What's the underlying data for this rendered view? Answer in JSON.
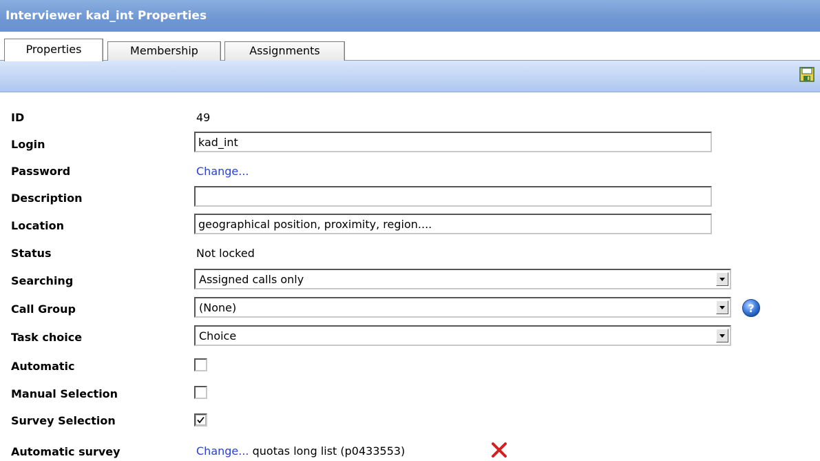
{
  "window": {
    "title": "Interviewer kad_int Properties"
  },
  "tabs": [
    {
      "label": "Properties",
      "active": true
    },
    {
      "label": "Membership",
      "active": false
    },
    {
      "label": "Assignments",
      "active": false
    }
  ],
  "toolbar": {
    "save_icon": "save-icon"
  },
  "form": {
    "id": {
      "label": "ID",
      "value": "49"
    },
    "login": {
      "label": "Login",
      "value": "kad_int"
    },
    "password": {
      "label": "Password",
      "link": "Change..."
    },
    "description": {
      "label": "Description",
      "value": ""
    },
    "location": {
      "label": "Location",
      "value": "geographical position, proximity, region...."
    },
    "status": {
      "label": "Status",
      "value": "Not locked"
    },
    "searching": {
      "label": "Searching",
      "value": "Assigned calls only"
    },
    "call_group": {
      "label": "Call Group",
      "value": "(None)",
      "help_icon": "help-icon"
    },
    "task_choice": {
      "label": "Task choice",
      "value": "Choice"
    },
    "automatic": {
      "label": "Automatic",
      "checked": false
    },
    "manual_selection": {
      "label": "Manual Selection",
      "checked": false
    },
    "survey_selection": {
      "label": "Survey Selection",
      "checked": true
    },
    "automatic_survey": {
      "label": "Automatic survey",
      "link": "Change...",
      "value": "quotas long list (p0433553)",
      "remove_icon": "remove-icon"
    }
  },
  "colors": {
    "title_bar": "#6f97d3",
    "toolbar": "#c3d6f5",
    "link": "#2a3fd6",
    "remove": "#d42020"
  }
}
